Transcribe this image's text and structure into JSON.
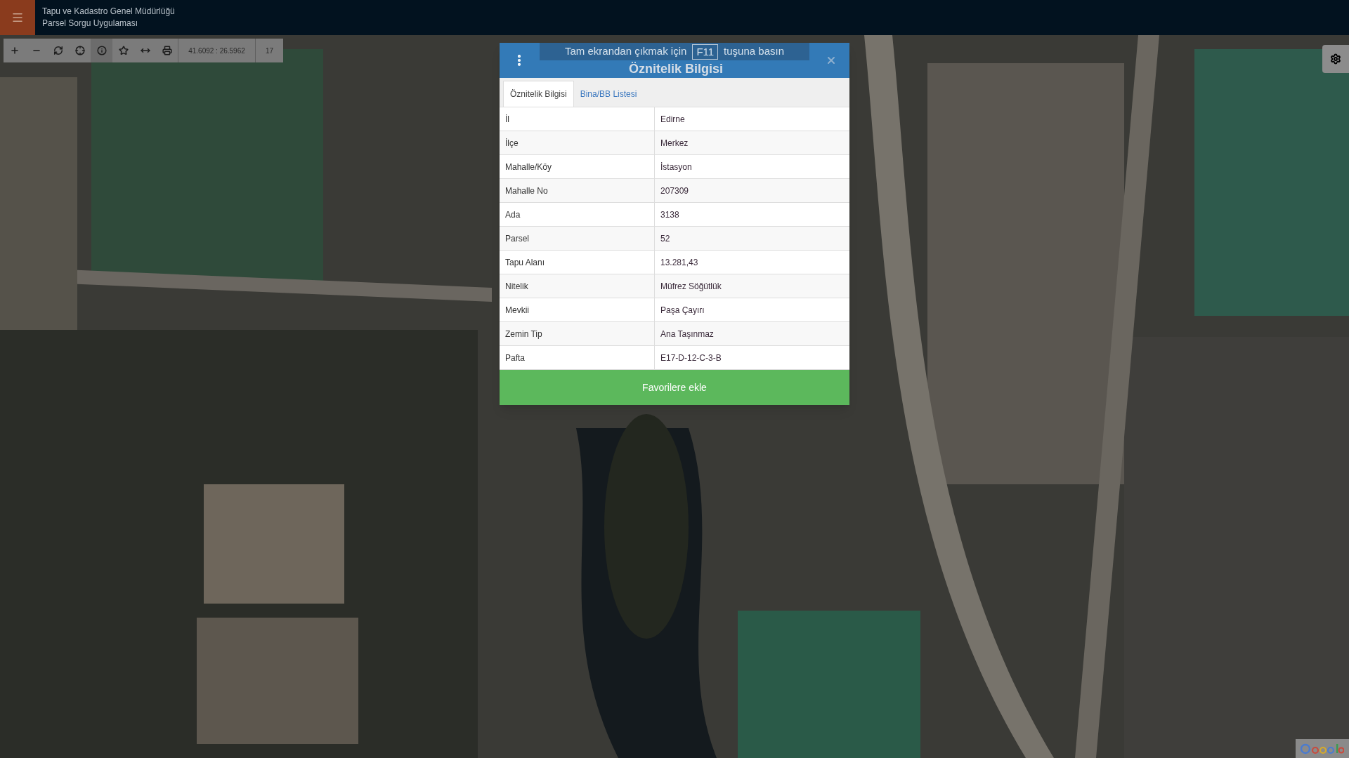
{
  "header": {
    "title": "Tapu ve Kadastro Genel Müdürlüğü",
    "subtitle": "Parsel Sorgu Uygulaması"
  },
  "toolbar": {
    "tools": [
      {
        "kind": "plus",
        "selected": false
      },
      {
        "kind": "minus",
        "selected": false
      },
      {
        "kind": "refresh",
        "selected": false
      },
      {
        "kind": "locate",
        "selected": false
      },
      {
        "kind": "info",
        "selected": true
      },
      {
        "kind": "star",
        "selected": false
      },
      {
        "kind": "measure",
        "selected": false
      },
      {
        "kind": "print",
        "selected": false
      }
    ],
    "coordinates": "41.6092 : 26.5962",
    "zoom": "17"
  },
  "fullscreen_notice": {
    "before": "Tam ekrandan çıkmak için",
    "key": "F11",
    "after": "tuşuna basın"
  },
  "dialog": {
    "title": "Öznitelik Bilgisi",
    "tabs": [
      {
        "label": "Öznitelik Bilgisi",
        "selected": true
      },
      {
        "label": "Bina/BB Listesi",
        "selected": false
      }
    ],
    "rows": [
      {
        "label": "İl",
        "value": "Edirne"
      },
      {
        "label": "İlçe",
        "value": "Merkez"
      },
      {
        "label": "Mahalle/Köy",
        "value": "İstasyon"
      },
      {
        "label": "Mahalle No",
        "value": "207309"
      },
      {
        "label": "Ada",
        "value": "3138"
      },
      {
        "label": "Parsel",
        "value": "52"
      },
      {
        "label": "Tapu Alanı",
        "value": "13.281,43"
      },
      {
        "label": "Nitelik",
        "value": "Müfrez Söğütlük"
      },
      {
        "label": "Mevkii",
        "value": "Paşa Çayırı"
      },
      {
        "label": "Zemin Tip",
        "value": "Ana Taşınmaz"
      },
      {
        "label": "Pafta",
        "value": "E17-D-12-C-3-B"
      }
    ],
    "button": "Favorilere ekle"
  }
}
